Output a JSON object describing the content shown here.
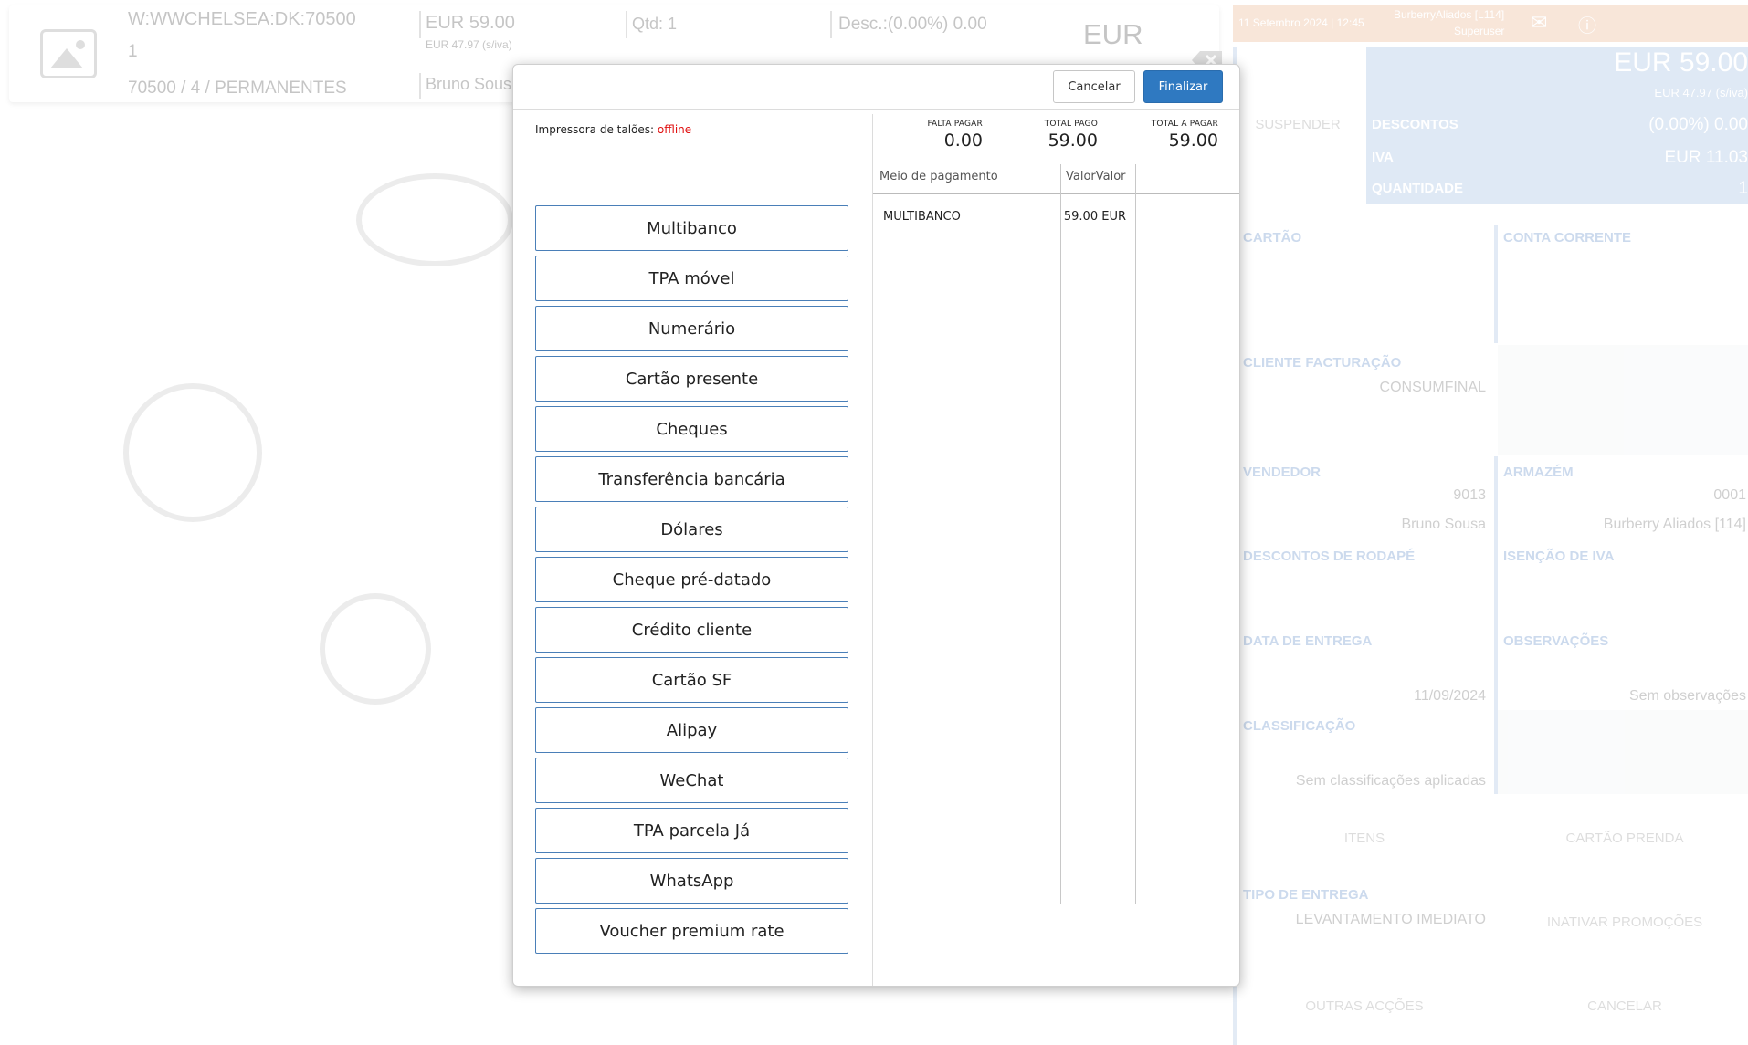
{
  "item": {
    "code": "W:WWCHELSEA:DK:70500",
    "line2": "1",
    "family": "70500 / 4 / PERMANENTES",
    "price": "EUR 59.00",
    "price_no_vat": "EUR 47.97 (s/iva)",
    "seller": "Bruno Sous",
    "qty": "Qtd: 1",
    "discount": "Desc.:(0.00%) 0.00",
    "currency": "EUR"
  },
  "side_panel": {
    "datetime": "11 Setembro 2024 | 12:45",
    "store": "BurberryAliados [L114]",
    "user": "Superuser",
    "suspend": "SUSPENDER",
    "total": "EUR 59.00",
    "total_no_vat": "EUR 47.97 (s/iva)",
    "discounts_label": "DESCONTOS",
    "discounts_value": "(0.00%) 0.00",
    "vat_label": "IVA",
    "vat_value": "EUR 11.03",
    "qty_label": "QUANTIDADE",
    "qty_value": "1",
    "card_label": "CARTÃO",
    "account_label": "CONTA CORRENTE",
    "billing_label": "CLIENTE FACTURAÇÃO",
    "billing_value": "CONSUMFINAL",
    "seller_label": "VENDEDOR",
    "seller_code": "9013",
    "seller_name": "Bruno Sousa",
    "warehouse_label": "ARMAZÉM",
    "warehouse_code": "0001",
    "warehouse_name": "Burberry Aliados [114]",
    "footer_disc_label": "DESCONTOS DE RODAPÉ",
    "vat_exempt_label": "ISENÇÃO DE IVA",
    "delivery_date_label": "DATA DE ENTREGA",
    "delivery_date_value": "11/09/2024",
    "notes_label": "OBSERVAÇÕES",
    "notes_value": "Sem observações",
    "class_label": "CLASSIFICAÇÃO",
    "class_value": "Sem classificações aplicadas",
    "items_btn": "ITENS",
    "gift_card_btn": "CARTÃO PRENDA",
    "delivery_type_label": "TIPO DE ENTREGA",
    "delivery_type_value": "LEVANTAMENTO IMEDIATO",
    "disable_promos_btn": "INATIVAR PROMOÇÕES",
    "other_actions_btn": "OUTRAS ACÇÕES",
    "cancel_btn": "CANCELAR"
  },
  "modal": {
    "cancel_label": "Cancelar",
    "finalize_label": "Finalizar",
    "printer_label": "Impressora de talões: ",
    "printer_status": "offline",
    "payment_methods": [
      "Multibanco",
      "TPA móvel",
      "Numerário",
      "Cartão presente",
      "Cheques",
      "Transferência bancária",
      "Dólares",
      "Cheque pré-datado",
      "Crédito cliente",
      "Cartão SF",
      "Alipay",
      "WeChat",
      "TPA parcela Já",
      "WhatsApp",
      "Voucher premium rate"
    ],
    "totals": {
      "remaining_label": "FALTA PAGAR",
      "remaining_value": "0.00",
      "paid_label": "TOTAL PAGO",
      "paid_value": "59.00",
      "due_label": "TOTAL A PAGAR",
      "due_value": "59.00"
    },
    "table": {
      "col_method": "Meio de pagamento",
      "col_value": "ValorValor",
      "rows": [
        {
          "method": "MULTIBANCO",
          "value": "59.00 EUR"
        }
      ]
    }
  },
  "colors": {
    "accent": "#2f79c1",
    "offline": "#e01010",
    "side_header": "#e9a77a",
    "side_total": "#8fb2dd"
  }
}
